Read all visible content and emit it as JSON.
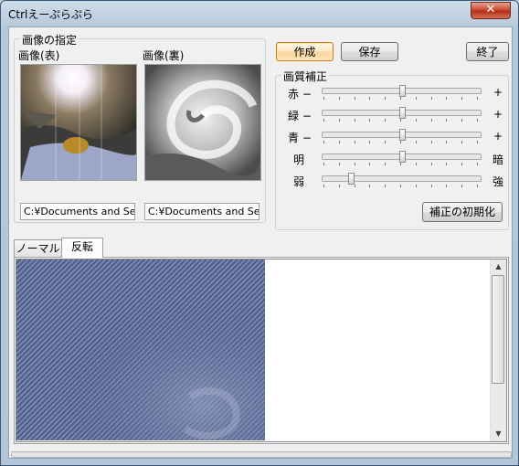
{
  "window": {
    "title": "Ctrlえーぷらぷら",
    "close_glyph": "✕"
  },
  "image_group": {
    "label": "画像の指定",
    "front": {
      "label": "画像(表)",
      "path": "C:¥Documents and Setti"
    },
    "back": {
      "label": "画像(裏)",
      "path": "C:¥Documents and Setti"
    }
  },
  "buttons": {
    "create": "作成",
    "save": "保存",
    "exit": "終了",
    "reset": "補正の初期化"
  },
  "correction": {
    "label": "画質補正",
    "sliders": [
      {
        "left": "赤 −",
        "right": "+",
        "value": 0.5
      },
      {
        "left": "緑 −",
        "right": "+",
        "value": 0.5
      },
      {
        "left": "青 −",
        "right": "+",
        "value": 0.5
      },
      {
        "left": "明",
        "right": "暗",
        "value": 0.5
      },
      {
        "left": "弱",
        "right": "強",
        "value": 0.17
      }
    ]
  },
  "tabs": [
    {
      "label": "ノーマル",
      "active": false
    },
    {
      "label": "反転",
      "active": true
    }
  ],
  "icons": {
    "scroll_up": "▲",
    "scroll_down": "▼"
  },
  "colors": {
    "accent": "#c97b1c",
    "preview": "#4a5a87"
  }
}
